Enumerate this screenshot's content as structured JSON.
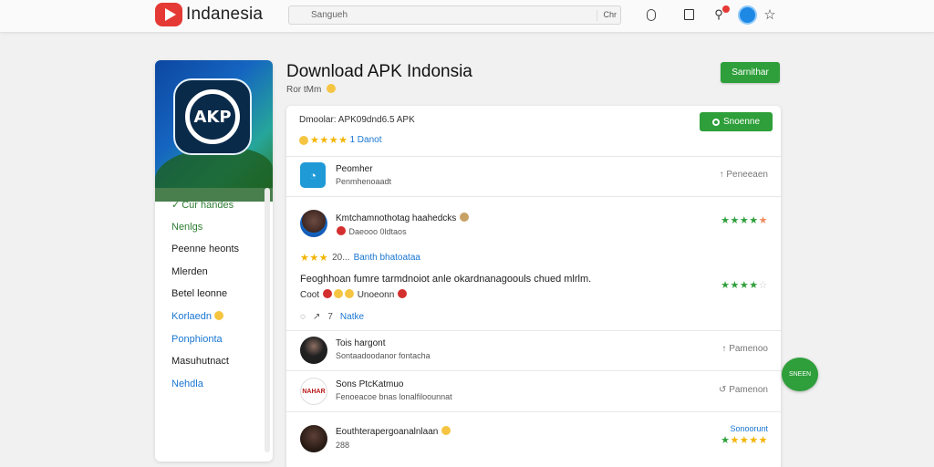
{
  "topbar": {
    "brand": "Indanesia",
    "search_placeholder": "Sangueh",
    "search_option": "Chr"
  },
  "sidebar": {
    "items": [
      {
        "label": "Cur handes",
        "style": "green",
        "check": true
      },
      {
        "label": "Nenlgs",
        "style": "green"
      },
      {
        "label": "Peenne heonts",
        "style": "green"
      },
      {
        "label": "Mlerden",
        "style": "default"
      },
      {
        "label": "Betel leonne",
        "style": "default"
      },
      {
        "label": "Korlaedn",
        "style": "blue",
        "coin": true
      },
      {
        "label": "Ponphionta",
        "style": "blue"
      },
      {
        "label": "Masuhutnact",
        "style": "default"
      },
      {
        "label": "Nehdla",
        "style": "blue"
      }
    ]
  },
  "header": {
    "title": "Download APK Indonsia",
    "subtitle": "Ror tMm",
    "primary_button": "Sarnithar"
  },
  "card": {
    "head_line": "Dmoolar: APK09dnd6.5 APK",
    "head_rating_suffix": "1  Danot",
    "head_button": "Snoenne"
  },
  "rows": [
    {
      "title": "Peomher",
      "subtitle": "Penmhenoaadt",
      "right": "Peneeaen",
      "right_glyph": "↑"
    },
    {
      "title": "Kmtchamnothotag haahedcks",
      "subtitle": "Daeooo 0ldtaos",
      "stars_num": "20...",
      "stars_link": "Banth bhatoataa",
      "body1": "Feoghhoan fumre tarmdnoiot anle okardnanagoouls chued mlrlm.",
      "body2_start": "Coot",
      "body2_end": "Unoeonn",
      "action_num": "7",
      "action_link": "Natke",
      "rating": 4.5,
      "rating2": 4
    },
    {
      "title": "Tois hargont",
      "subtitle": "Sontaadoodanor fontacha",
      "right": "Pamenoo",
      "right_glyph": "↑"
    },
    {
      "title": "Sons PtcKatmuo",
      "subtitle": "Fenoeacoe bnas lonalfiloounnat",
      "right": "Pamenon",
      "right_glyph": "↺",
      "avatar_text": "NAHAR"
    },
    {
      "title": "Eouthterapergoanalnlaan",
      "subtitle": "288",
      "right_label": "Sonoorunt",
      "rating": 4.5
    }
  ],
  "float_badge": "SNEEN",
  "colors": {
    "accent_green": "#2e9f3a",
    "brand_red": "#e53935",
    "link_blue": "#1976d2",
    "star_gold": "#f4b400"
  }
}
